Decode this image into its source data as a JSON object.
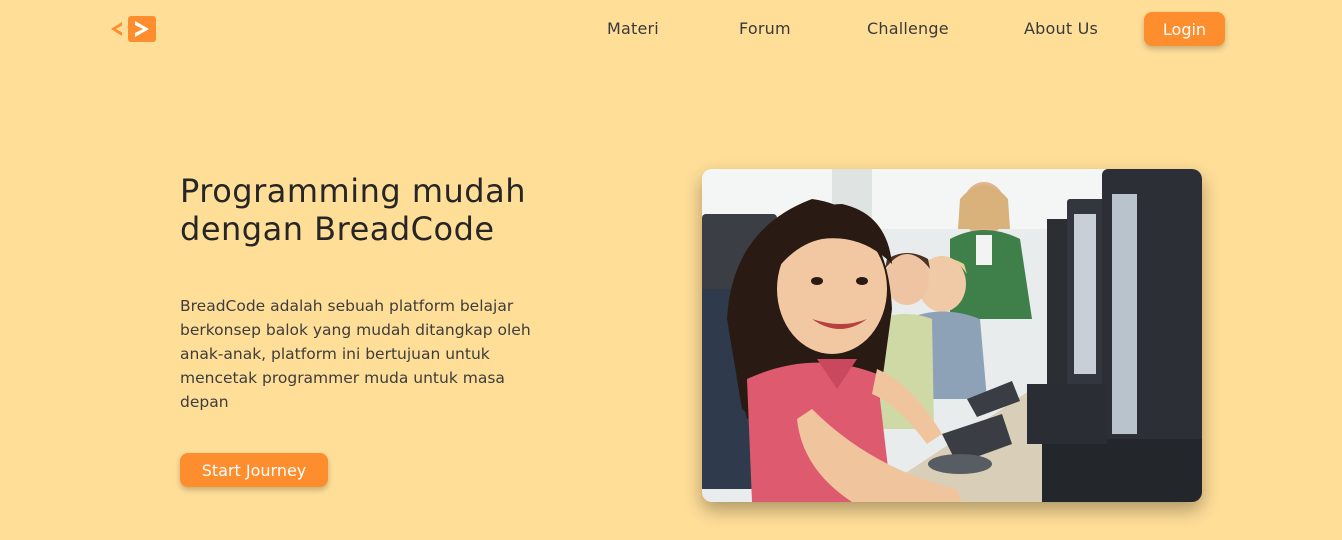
{
  "brand": {
    "logo_icon": "code-bracket-logo-icon",
    "accent_color": "#fd8d2d",
    "background_color": "#ffde98"
  },
  "nav": {
    "items": [
      {
        "label": "Materi"
      },
      {
        "label": "Forum"
      },
      {
        "label": "Challenge"
      },
      {
        "label": "About Us"
      }
    ],
    "login_label": "Login"
  },
  "hero": {
    "title": "Programming mudah dengan BreadCode",
    "description": "BreadCode adalah sebuah platform belajar berkonsep balok yang mudah ditangkap oleh anak-anak, platform ini bertujuan untuk mencetak programmer muda untuk masa depan",
    "cta_label": "Start Journey",
    "image_subject": "children-using-computers-in-classroom"
  }
}
